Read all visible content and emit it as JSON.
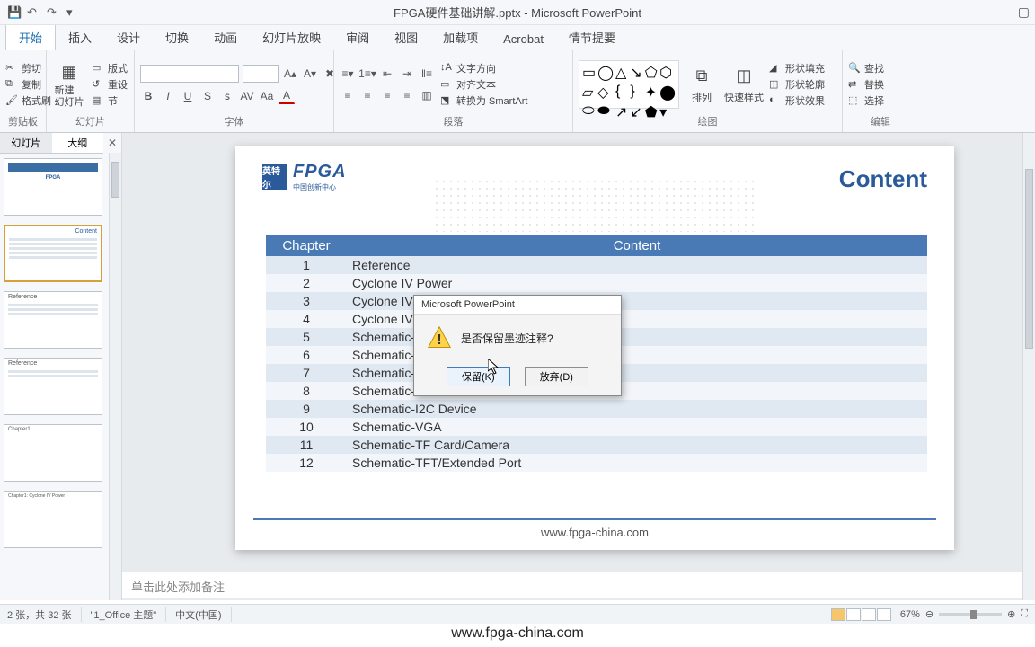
{
  "window": {
    "title": "FPGA硬件基础讲解.pptx - Microsoft PowerPoint"
  },
  "ribbon_tabs": {
    "t0": "开始",
    "t1": "插入",
    "t2": "设计",
    "t3": "切换",
    "t4": "动画",
    "t5": "幻灯片放映",
    "t6": "审阅",
    "t7": "视图",
    "t8": "加载项",
    "t9": "Acrobat",
    "t10": "情节提要"
  },
  "ribbon": {
    "clipboard": {
      "label": "剪贴板",
      "cut": "剪切",
      "copy": "复制",
      "format_painter": "格式刷"
    },
    "slides": {
      "label": "幻灯片",
      "new_slide": "新建\n幻灯片",
      "layout": "版式",
      "reset": "重设",
      "section": "节"
    },
    "font": {
      "label": "字体"
    },
    "paragraph": {
      "label": "段落",
      "text_dir": "文字方向",
      "align_text": "对齐文本",
      "convert_smart": "转换为 SmartArt"
    },
    "drawing": {
      "label": "绘图",
      "arrange": "排列",
      "quick_style": "快速样式",
      "fill": "形状填充",
      "outline": "形状轮廓",
      "effects": "形状效果"
    },
    "editing": {
      "label": "编辑",
      "find": "查找",
      "replace": "替换",
      "select": "选择"
    }
  },
  "pane": {
    "slides_tab": "幻灯片",
    "outline_tab": "大纲"
  },
  "slide": {
    "logo_main": "FPGA",
    "logo_sub": "中国创新中心",
    "logo_badge": "英特尔",
    "title": "Content",
    "table_head": {
      "col1": "Chapter",
      "col2": "Content"
    },
    "rows": [
      {
        "n": "1",
        "t": "Reference"
      },
      {
        "n": "2",
        "t": "Cyclone IV Power"
      },
      {
        "n": "3",
        "t": "Cyclone IV Clock"
      },
      {
        "n": "4",
        "t": "Cyclone IV Config"
      },
      {
        "n": "5",
        "t": "Schematic-USB to UART"
      },
      {
        "n": "6",
        "t": "Schematic-LED/Button"
      },
      {
        "n": "7",
        "t": "Schematic-Buzzer/7SEG"
      },
      {
        "n": "8",
        "t": "Schematic-SDRAM"
      },
      {
        "n": "9",
        "t": "Schematic-I2C Device"
      },
      {
        "n": "10",
        "t": "Schematic-VGA"
      },
      {
        "n": "11",
        "t": "Schematic-TF Card/Camera"
      },
      {
        "n": "12",
        "t": "Schematic-TFT/Extended Port"
      }
    ],
    "url": "www.fpga-china.com"
  },
  "dialog": {
    "title": "Microsoft PowerPoint",
    "message": "是否保留墨迹注释?",
    "btn_keep": "保留(K)",
    "btn_discard": "放弃(D)"
  },
  "notes": {
    "placeholder": "单击此处添加备注"
  },
  "status": {
    "slide_count": "2 张，共 32 张",
    "theme": "\"1_Office 主题\"",
    "lang": "中文(中国)",
    "zoom": "67%"
  },
  "overlay_url": "www.fpga-china.com"
}
